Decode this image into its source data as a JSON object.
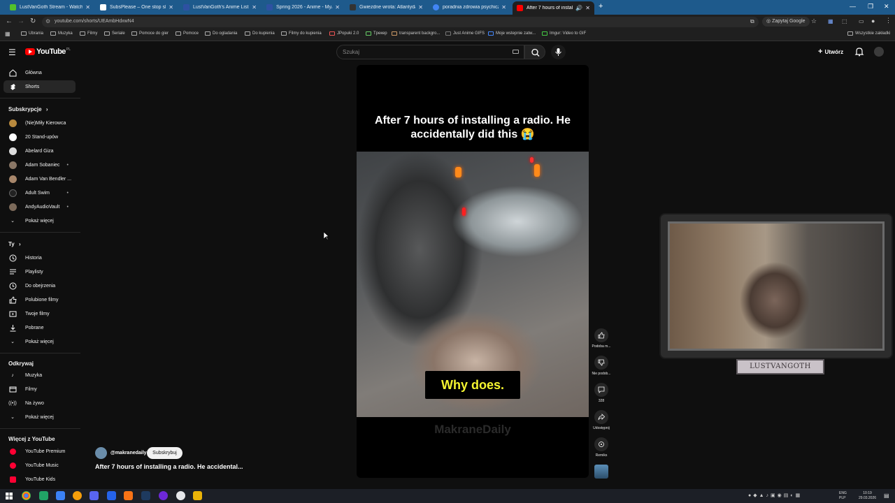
{
  "browser": {
    "tabs": [
      {
        "label": "LustVanGoth Stream - Watch Li",
        "color": "#53c22b"
      },
      {
        "label": "SubsPlease – One stop shop fo",
        "color": "#ffffff"
      },
      {
        "label": "LustVanGoth's Anime List - My",
        "color": "#2e51a2"
      },
      {
        "label": "Spring 2026 - Anime - MyAnim",
        "color": "#2e51a2"
      },
      {
        "label": "Gwiezdne wrota: Atlantyda / St",
        "color": "#333333"
      },
      {
        "label": "poradnia zdrowia psychicznego",
        "color": "#4285f4"
      },
      {
        "label": "After 7 hours of installing a",
        "color": "#ff0000"
      }
    ],
    "url": "youtube.com/shorts/UEAmbHdxwN4",
    "ask_google": "Zapytaj Google",
    "bookmarks": [
      "Ubrania",
      "Muzyka",
      "Filmy",
      "Seriale",
      "Pomoce do gier",
      "Pomoce",
      "Do ogladania",
      "Do kupienia",
      "Filmy do kupienia",
      "JPopuki 2.0",
      "Tpeкep",
      "transparent backgro...",
      "Just Anime GIFS",
      "Moje wstepnie zatw...",
      "Imgur: Video to GIF"
    ],
    "all_bookmarks": "Wszystkie zakładki"
  },
  "youtube": {
    "logo_text": "YouTube",
    "country_code": "PL",
    "search_placeholder": "Szukaj",
    "create_label": "Utwórz",
    "sidebar": {
      "main": [
        {
          "label": "Główna"
        },
        {
          "label": "Shorts"
        }
      ],
      "subs_header": "Subskrypcje",
      "subs": [
        {
          "label": "(Nie)Miły Kierowca",
          "color": "#b98a3e"
        },
        {
          "label": "20 Stand-upów",
          "color": "#ffffff"
        },
        {
          "label": "Abelard Giza",
          "color": "#dddddd"
        },
        {
          "label": "Adam Sobaniec",
          "color": "#8a7766"
        },
        {
          "label": "Adam Van Bendler ...",
          "color": "#a8876b"
        },
        {
          "label": "Adult Swim",
          "color": "#222222"
        },
        {
          "label": "AndyAudioVault",
          "color": "#7c6a5a"
        }
      ],
      "more_subs": "Pokaż więcej",
      "you_header": "Ty",
      "you": [
        {
          "label": "Historia"
        },
        {
          "label": "Playlisty"
        },
        {
          "label": "Do obejrzenia"
        },
        {
          "label": "Polubione filmy"
        },
        {
          "label": "Twoje filmy"
        },
        {
          "label": "Pobrane"
        }
      ],
      "more_you": "Pokaż więcej",
      "explore_header": "Odkrywaj",
      "explore": [
        {
          "label": "Muzyka"
        },
        {
          "label": "Filmy"
        },
        {
          "label": "Na żywo"
        }
      ],
      "more_explore": "Pokaż więcej",
      "more_yt_header": "Więcej z YouTube",
      "more_yt": [
        {
          "label": "YouTube Premium"
        },
        {
          "label": "YouTube Music"
        },
        {
          "label": "YouTube Kids"
        }
      ]
    },
    "short": {
      "caption": "After 7 hours of installing a radio. He accidentally did this 😭",
      "subtitle": "Why does.",
      "watermark": "MakraneDaily",
      "channel": "@makranedaily",
      "subscribe": "Subskrybuj",
      "title": "After 7 hours of installing a radio. He accidental..."
    },
    "actions": {
      "like": "Podoba m...",
      "dislike": "Nie podob...",
      "comments": "328",
      "share": "Udostępnij",
      "remix": "Remiks"
    }
  },
  "overlay": {
    "webcam_label": "LUSTVANGOTH"
  },
  "taskbar": {
    "lang_top": "ENG",
    "lang_bottom": "PLP",
    "time": "10:19",
    "date": "29.03.2026"
  }
}
